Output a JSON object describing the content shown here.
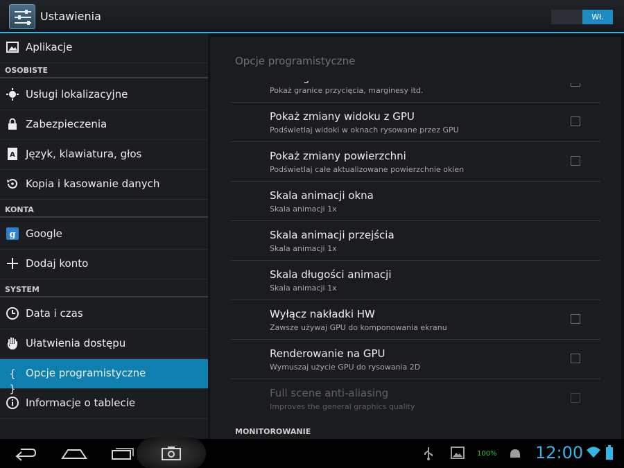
{
  "actionbar": {
    "title": "Ustawienia",
    "switch_label": "Wł.",
    "icon": "settings-sliders-icon"
  },
  "sidebar": {
    "items": [
      {
        "label": "Aplikacje",
        "icon": "picture-icon"
      },
      {
        "header": "OSOBISTE"
      },
      {
        "label": "Usługi lokalizacyjne",
        "icon": "location-icon"
      },
      {
        "label": "Zabezpieczenia",
        "icon": "lock-icon"
      },
      {
        "label": "Język, klawiatura, głos",
        "icon": "keyboard-icon"
      },
      {
        "label": "Kopia i kasowanie danych",
        "icon": "backup-icon"
      },
      {
        "header": "KONTA"
      },
      {
        "label": "Google",
        "icon": "google-icon"
      },
      {
        "label": "Dodaj konto",
        "icon": "plus-icon"
      },
      {
        "header": "SYSTEM"
      },
      {
        "label": "Data i czas",
        "icon": "clock-icon"
      },
      {
        "label": "Ułatwienia dostępu",
        "icon": "hand-icon"
      },
      {
        "label": "Opcje programistyczne",
        "icon": "braces-icon",
        "selected": true
      },
      {
        "label": "Informacje o tablecie",
        "icon": "info-icon"
      }
    ]
  },
  "detail": {
    "title": "Opcje programistyczne",
    "prefs": [
      {
        "title": "Pokaż granice",
        "summary": "Pokaż granice przycięcia, marginesy itd.",
        "checkbox": true
      },
      {
        "title": "Pokaż zmiany widoku z GPU",
        "summary": "Podświetlaj widoki w oknach rysowane przez GPU",
        "checkbox": true
      },
      {
        "title": "Pokaż zmiany powierzchni",
        "summary": "Podświetlaj całe aktualizowane powierzchnie okien",
        "checkbox": true
      },
      {
        "title": "Skala animacji okna",
        "summary": "Skala animacji 1x",
        "checkbox": false
      },
      {
        "title": "Skala animacji przejścia",
        "summary": "Skala animacji 1x",
        "checkbox": false
      },
      {
        "title": "Skala długości animacji",
        "summary": "Skala animacji 1x",
        "checkbox": false
      },
      {
        "title": "Wyłącz nakładki HW",
        "summary": "Zawsze używaj GPU do komponowania ekranu",
        "checkbox": true
      },
      {
        "title": "Renderowanie na GPU",
        "summary": "Wymuszaj użycie GPU do rysowania 2D",
        "checkbox": true
      },
      {
        "title": "Full scene anti-aliasing",
        "summary": "Improves the general graphics quality",
        "checkbox": true,
        "disabled": true
      }
    ],
    "category": "MONITOROWANIE"
  },
  "systembar": {
    "clock": "12:00",
    "battery_pct": "100%",
    "clock_color": "#33b5e5",
    "nav_icons": [
      "back-icon",
      "home-icon",
      "recent-apps-icon",
      "screenshot-icon"
    ],
    "tray_icons": [
      "usb-icon",
      "gallery-icon",
      "android-icon",
      "wifi-icon",
      "battery-icon"
    ]
  },
  "colors": {
    "accent": "#33b5e5",
    "selection": "#0f7fb0"
  }
}
